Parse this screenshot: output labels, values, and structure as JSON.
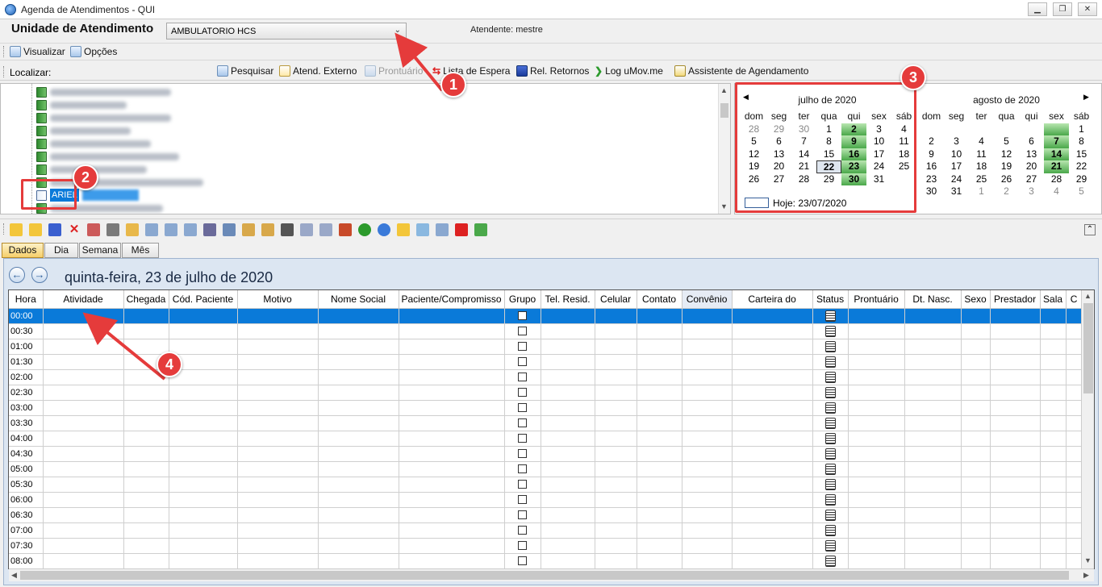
{
  "window": {
    "title": "Agenda de Atendimentos - QUI",
    "controls": [
      "minimize",
      "restore",
      "close"
    ]
  },
  "unit": {
    "label": "Unidade de Atendimento",
    "selected": "AMBULATORIO HCS",
    "attendant": "Atendente: mestre"
  },
  "menu": {
    "visualizar": "Visualizar",
    "opcoes": "Opções"
  },
  "locate_toolbar": {
    "label": "Localizar:",
    "items": [
      "Pesquisar",
      "Atend. Externo",
      "Prontuário",
      "Lista de Espera",
      "Rel. Retornos",
      "Log uMov.me",
      "Assistente de Agendamento"
    ]
  },
  "tree": {
    "selected_label": "ARIEL"
  },
  "calendar": {
    "weekday_headers": [
      "dom",
      "seg",
      "ter",
      "qua",
      "qui",
      "sex",
      "sáb"
    ],
    "month1": {
      "title": "julho de 2020",
      "days": [
        "28",
        "29",
        "30",
        "1",
        "2",
        "3",
        "4",
        "5",
        "6",
        "7",
        "8",
        "9",
        "10",
        "11",
        "12",
        "13",
        "14",
        "15",
        "16",
        "17",
        "18",
        "19",
        "20",
        "21",
        "22",
        "23",
        "24",
        "25",
        "26",
        "27",
        "28",
        "29",
        "30",
        "31",
        ""
      ],
      "gray_indexes": [
        0,
        1,
        2
      ],
      "green_indexes": [
        4,
        11,
        18,
        25,
        32
      ],
      "today_index": 24
    },
    "month2": {
      "title": "agosto de 2020",
      "days": [
        "",
        "",
        "",
        "",
        "",
        "",
        "1",
        "2",
        "3",
        "4",
        "5",
        "6",
        "7",
        "8",
        "9",
        "10",
        "11",
        "12",
        "13",
        "14",
        "15",
        "16",
        "17",
        "18",
        "19",
        "20",
        "21",
        "22",
        "23",
        "24",
        "25",
        "26",
        "27",
        "28",
        "29",
        "30",
        "31",
        "1",
        "2",
        "3",
        "4",
        "5"
      ],
      "gray_indexes": [
        37,
        38,
        39,
        40,
        41
      ],
      "green_indexes": [
        5,
        12,
        19,
        26
      ]
    },
    "today_text": "Hoje: 23/07/2020"
  },
  "tabs": [
    "Dados",
    "Dia",
    "Semana",
    "Mês"
  ],
  "date_title": "quinta-feira, 23 de julho de 2020",
  "grid": {
    "columns": [
      "Hora",
      "Atividade",
      "Chegada",
      "Cód. Paciente",
      "Motivo",
      "Nome Social",
      "Paciente/Compromisso",
      "Grupo",
      "Tel. Resid.",
      "Celular",
      "Contato",
      "Convênio",
      "Carteira do",
      "Status",
      "Prontuário",
      "Dt. Nasc.",
      "Sexo",
      "Prestador",
      "Sala",
      "C"
    ],
    "rows": [
      "00:00",
      "00:30",
      "01:00",
      "01:30",
      "02:00",
      "02:30",
      "03:00",
      "03:30",
      "04:00",
      "04:30",
      "05:00",
      "05:30",
      "06:00",
      "06:30",
      "07:00",
      "07:30",
      "08:00"
    ]
  },
  "annotations": [
    "1",
    "2",
    "3",
    "4"
  ],
  "colors": {
    "selection": "#0a7ad9",
    "annotation": "#e53b3b",
    "calendar_marked": "#4aa84a"
  }
}
